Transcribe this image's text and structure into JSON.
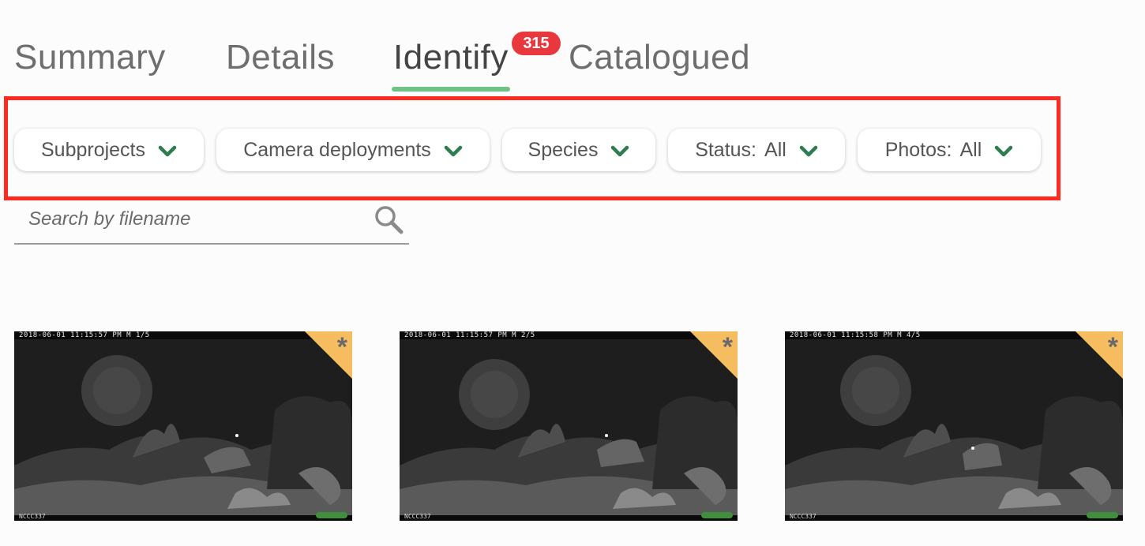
{
  "tabs": {
    "summary": "Summary",
    "details": "Details",
    "identify": "Identify",
    "catalogued": "Catalogued",
    "identify_badge": "315",
    "active": "identify"
  },
  "filters": {
    "subprojects": {
      "label": "Subprojects"
    },
    "camera_deployments": {
      "label": "Camera deployments"
    },
    "species": {
      "label": "Species"
    },
    "status": {
      "label": "Status:",
      "value": "All"
    },
    "photos": {
      "label": "Photos:",
      "value": "All"
    }
  },
  "search": {
    "placeholder": "Search by filename",
    "value": ""
  },
  "photos": [
    {
      "timestamp": "2018-06-01 11:15:57 PM  M 1/5",
      "camera": "NCCC337",
      "marker": "*"
    },
    {
      "timestamp": "2018-06-01 11:15:57 PM  M 2/5",
      "camera": "NCCC337",
      "marker": "*"
    },
    {
      "timestamp": "2018-06-01 11:15:58 PM  M 4/5",
      "camera": "NCCC337",
      "marker": "*"
    }
  ],
  "icons": {
    "chevron": "chevron-down-icon",
    "search": "search-icon"
  },
  "colors": {
    "tab_underline": "#6fc188",
    "badge": "#e8383d",
    "highlight_frame": "#ff2a1f",
    "chevron": "#2e7d4f",
    "corner_flag": "#f6bd60"
  }
}
